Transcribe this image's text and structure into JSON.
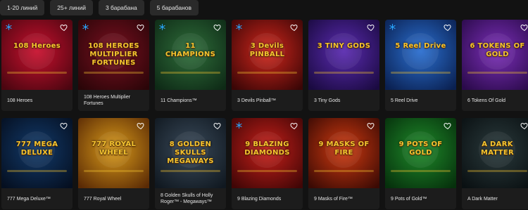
{
  "filters": [
    "1-20 линий",
    "25+ линий",
    "3 барабана",
    "5 барабанов"
  ],
  "games": [
    {
      "title": "108 Heroes",
      "logo": "108 Heroes",
      "bg1": "#c8102e",
      "bg2": "#4a0610",
      "snow": true
    },
    {
      "title": "108 Heroes Multiplier Fortunes",
      "logo": "108 HEROES MULTIPLIER FORTUNES",
      "bg1": "#7a1020",
      "bg2": "#2a0508",
      "snow": true
    },
    {
      "title": "11 Champions™",
      "logo": "11 CHAMPIONS",
      "bg1": "#2f6e3a",
      "bg2": "#0e2a16",
      "snow": true
    },
    {
      "title": "3 Devils Pinball™",
      "logo": "3 Devils PINBALL",
      "bg1": "#d0261c",
      "bg2": "#3a0606",
      "snow": true
    },
    {
      "title": "3 Tiny Gods",
      "logo": "3 TINY GODS",
      "bg1": "#5a2bb0",
      "bg2": "#1a0a40",
      "snow": false
    },
    {
      "title": "5 Reel Drive",
      "logo": "5 Reel Drive",
      "bg1": "#2b6fd0",
      "bg2": "#0a2050",
      "snow": true
    },
    {
      "title": "6 Tokens Of Gold",
      "logo": "6 TOKENS OF GOLD",
      "bg1": "#7b2fb8",
      "bg2": "#2a0a4a",
      "snow": false
    },
    {
      "title": "777 Mega Deluxe™",
      "logo": "777 MEGA DELUXE",
      "bg1": "#123a6a",
      "bg2": "#050f20",
      "snow": false
    },
    {
      "title": "777 Royal Wheel",
      "logo": "777 ROYAL WHEEL",
      "bg1": "#d89a1a",
      "bg2": "#5a2a05",
      "snow": false
    },
    {
      "title": "8 Golden Skulls of Holly Roger™ - Megaways™",
      "logo": "8 GOLDEN SKULLS MEGAWAYS",
      "bg1": "#3a4a5a",
      "bg2": "#101820",
      "snow": false
    },
    {
      "title": "9 Blazing Diamonds",
      "logo": "9 BLAZING DIAMONDS",
      "bg1": "#c8201a",
      "bg2": "#400606",
      "snow": true
    },
    {
      "title": "9 Masks of Fire™",
      "logo": "9 MASKS OF FIRE",
      "bg1": "#d03a10",
      "bg2": "#3a0a04",
      "snow": false
    },
    {
      "title": "9 Pots of Gold™",
      "logo": "9 POTS OF GOLD",
      "bg1": "#1f8a2a",
      "bg2": "#06300c",
      "snow": false
    },
    {
      "title": "A Dark Matter",
      "logo": "A DARK MATTER",
      "bg1": "#2a3a3c",
      "bg2": "#0a1012",
      "snow": false
    }
  ],
  "colors": {
    "heart": "#ffffff",
    "snow": "#2aa8ff",
    "gold": "#f4c430"
  }
}
